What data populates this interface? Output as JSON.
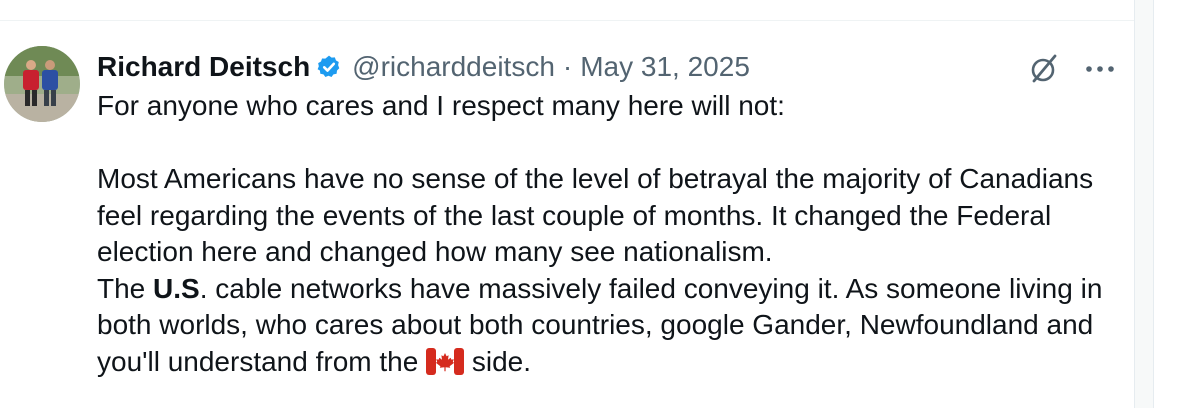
{
  "tweet": {
    "author_name": "Richard Deitsch",
    "handle": "@richarddeitsch",
    "separator": "·",
    "date": "May 31, 2025",
    "more_label": "···",
    "verified_color": "#1d9bf0",
    "line_intro": "For anyone who cares and I respect many here will not:",
    "para_1": "Most Americans have no sense of the level of betrayal the majority of Canadians feel regarding the events of the last couple of months. It changed the Federal election here and changed how many see nationalism.",
    "para_2_pre": "The ",
    "para_2_bold": "U.S",
    "para_2_post": ". cable networks have massively failed conveying it. As someone living in both worlds, who cares about both countries, google Gander, Newfoundland and you'll understand from the ",
    "para_2_end": " side.",
    "flag_icon": "canada-flag-icon"
  }
}
